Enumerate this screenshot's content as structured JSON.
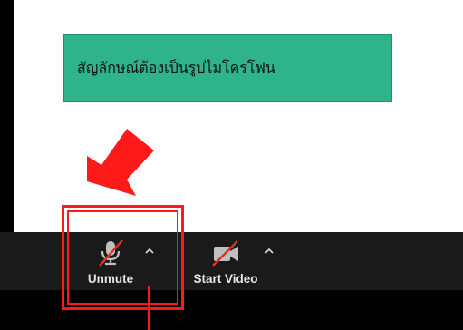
{
  "callout": {
    "text": "สัญลักษณ์ต้องเป็นรูปไมโครโฟน"
  },
  "toolbar": {
    "unmute_label": "Unmute",
    "start_video_label": "Start Video",
    "icons": {
      "mic": "muted-microphone-icon",
      "video": "video-off-icon",
      "caret": "chevron-up-icon"
    }
  },
  "annotations": {
    "color": "#ff1a1a",
    "arrow_color": "#ff1a1a",
    "callout_color": "#2eb38b"
  }
}
